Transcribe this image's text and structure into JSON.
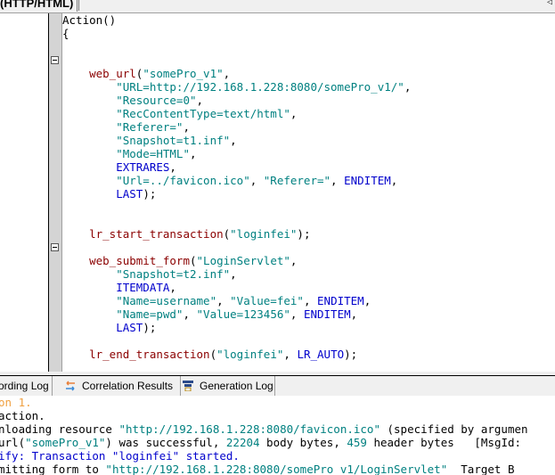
{
  "top_tab": {
    "label": "(HTTP/HTML)"
  },
  "code_lines": [
    [
      {
        "t": "Action()",
        "c": ""
      }
    ],
    [
      {
        "t": "{",
        "c": ""
      }
    ],
    [],
    [],
    [
      {
        "t": "    web_url",
        "c": "fn"
      },
      {
        "t": "(",
        "c": ""
      },
      {
        "t": "\"somePro_v1\"",
        "c": "str"
      },
      {
        "t": ",",
        "c": ""
      }
    ],
    [
      {
        "t": "        \"URL=http://192.168.1.228:8080/somePro_v1/\"",
        "c": "str"
      },
      {
        "t": ",",
        "c": ""
      }
    ],
    [
      {
        "t": "        \"Resource=0\"",
        "c": "str"
      },
      {
        "t": ",",
        "c": ""
      }
    ],
    [
      {
        "t": "        \"RecContentType=text/html\"",
        "c": "str"
      },
      {
        "t": ",",
        "c": ""
      }
    ],
    [
      {
        "t": "        \"Referer=\"",
        "c": "str"
      },
      {
        "t": ",",
        "c": ""
      }
    ],
    [
      {
        "t": "        \"Snapshot=t1.inf\"",
        "c": "str"
      },
      {
        "t": ",",
        "c": ""
      }
    ],
    [
      {
        "t": "        \"Mode=HTML\"",
        "c": "str"
      },
      {
        "t": ",",
        "c": ""
      }
    ],
    [
      {
        "t": "        EXTRARES",
        "c": "kw"
      },
      {
        "t": ",",
        "c": ""
      }
    ],
    [
      {
        "t": "        \"Url=../favicon.ico\"",
        "c": "str"
      },
      {
        "t": ", ",
        "c": ""
      },
      {
        "t": "\"Referer=\"",
        "c": "str"
      },
      {
        "t": ", ",
        "c": ""
      },
      {
        "t": "ENDITEM",
        "c": "kw"
      },
      {
        "t": ",",
        "c": ""
      }
    ],
    [
      {
        "t": "        LAST",
        "c": "kw"
      },
      {
        "t": ");",
        "c": ""
      }
    ],
    [],
    [],
    [
      {
        "t": "    lr_start_transaction",
        "c": "fn"
      },
      {
        "t": "(",
        "c": ""
      },
      {
        "t": "\"loginfei\"",
        "c": "str"
      },
      {
        "t": ");",
        "c": ""
      }
    ],
    [],
    [
      {
        "t": "    web_submit_form",
        "c": "fn"
      },
      {
        "t": "(",
        "c": ""
      },
      {
        "t": "\"LoginServlet\"",
        "c": "str"
      },
      {
        "t": ",",
        "c": ""
      }
    ],
    [
      {
        "t": "        \"Snapshot=t2.inf\"",
        "c": "str"
      },
      {
        "t": ",",
        "c": ""
      }
    ],
    [
      {
        "t": "        ITEMDATA",
        "c": "kw"
      },
      {
        "t": ",",
        "c": ""
      }
    ],
    [
      {
        "t": "        \"Name=username\"",
        "c": "str"
      },
      {
        "t": ", ",
        "c": ""
      },
      {
        "t": "\"Value=fei\"",
        "c": "str"
      },
      {
        "t": ", ",
        "c": ""
      },
      {
        "t": "ENDITEM",
        "c": "kw"
      },
      {
        "t": ",",
        "c": ""
      }
    ],
    [
      {
        "t": "        \"Name=pwd\"",
        "c": "str"
      },
      {
        "t": ", ",
        "c": ""
      },
      {
        "t": "\"Value=123456\"",
        "c": "str"
      },
      {
        "t": ", ",
        "c": ""
      },
      {
        "t": "ENDITEM",
        "c": "kw"
      },
      {
        "t": ",",
        "c": ""
      }
    ],
    [
      {
        "t": "        LAST",
        "c": "kw"
      },
      {
        "t": ");",
        "c": ""
      }
    ],
    [],
    [
      {
        "t": "    lr_end_transaction",
        "c": "fn"
      },
      {
        "t": "(",
        "c": ""
      },
      {
        "t": "\"loginfei\"",
        "c": "str"
      },
      {
        "t": ", ",
        "c": ""
      },
      {
        "t": "LR_AUTO",
        "c": "kw"
      },
      {
        "t": ");",
        "c": ""
      }
    ]
  ],
  "bottom_tabs": [
    {
      "label": "ording Log",
      "icon": "none"
    },
    {
      "label": "Correlation Results",
      "icon": "correlation-icon"
    },
    {
      "label": "Generation Log",
      "icon": "generation-log-icon"
    }
  ],
  "output_lines": [
    [
      {
        "t": "on 1.",
        "c": "orange"
      }
    ],
    [
      {
        "t": "action.",
        "c": ""
      }
    ],
    [
      {
        "t": "nloading resource ",
        "c": ""
      },
      {
        "t": "\"http://192.168.1.228:8080/favicon.ico\"",
        "c": "teal"
      },
      {
        "t": " (specified by argumen",
        "c": ""
      }
    ],
    [
      {
        "t": "url(",
        "c": ""
      },
      {
        "t": "\"somePro_v1\"",
        "c": "teal"
      },
      {
        "t": ") was successful, ",
        "c": ""
      },
      {
        "t": "22204",
        "c": "teal"
      },
      {
        "t": " body bytes, ",
        "c": ""
      },
      {
        "t": "459",
        "c": "teal"
      },
      {
        "t": " header bytes   [MsgId:",
        "c": ""
      }
    ],
    [
      {
        "t": "ify: Transaction \"loginfei\" started.",
        "c": "blue"
      }
    ],
    [
      {
        "t": "mitting form to ",
        "c": ""
      },
      {
        "t": "\"http://192.168.1.228:8080/somePro_v1/LoginServlet\"",
        "c": "teal"
      },
      {
        "t": "  Target B",
        "c": ""
      }
    ]
  ]
}
